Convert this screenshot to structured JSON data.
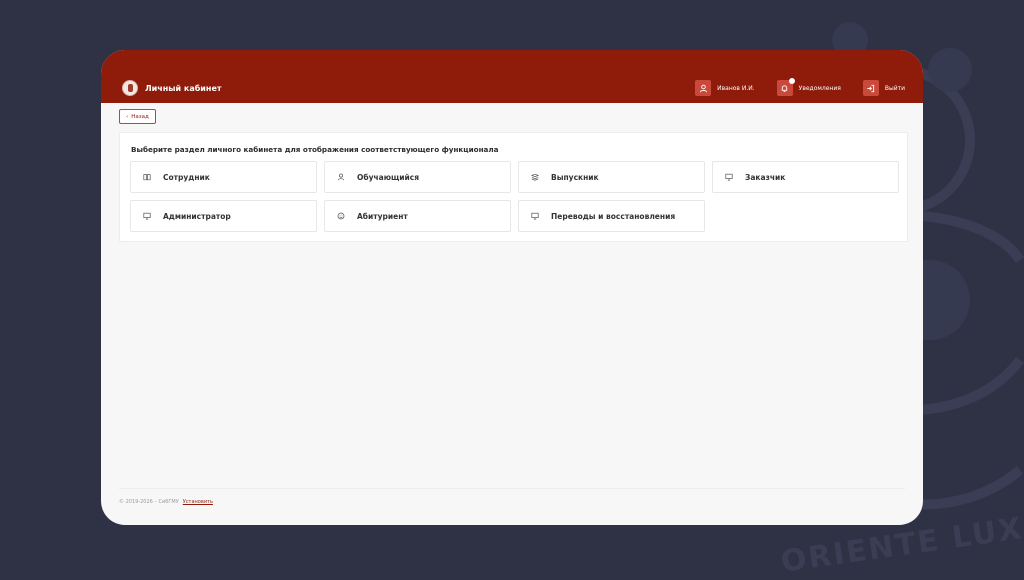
{
  "header": {
    "title": "Личный кабинет",
    "user_label": "Иванов И.И.",
    "notifications_label": "Уведомления",
    "logout_label": "Выйти"
  },
  "back_button": {
    "label": "Назад"
  },
  "panel": {
    "title": "Выберите раздел личного кабинета для отображения соответствующего функционала",
    "tiles": [
      {
        "label": "Сотрудник",
        "icon": "book-icon"
      },
      {
        "label": "Обучающийся",
        "icon": "user-icon"
      },
      {
        "label": "Выпускник",
        "icon": "layers-icon"
      },
      {
        "label": "Заказчик",
        "icon": "monitor-icon"
      },
      {
        "label": "Администратор",
        "icon": "monitor-icon"
      },
      {
        "label": "Абитуриент",
        "icon": "smile-icon"
      },
      {
        "label": "Переводы и восстановления",
        "icon": "monitor-icon"
      }
    ]
  },
  "footer": {
    "copyright": "© 2019-2026 – СибГМУ",
    "install_link": "Установить"
  },
  "background": {
    "motto": "ORIENTE LUX"
  },
  "colors": {
    "accent": "#8f1b0b",
    "icon_box": "#c94a3a",
    "page_bg": "#2f3245",
    "content_bg": "#f7f7f7"
  }
}
